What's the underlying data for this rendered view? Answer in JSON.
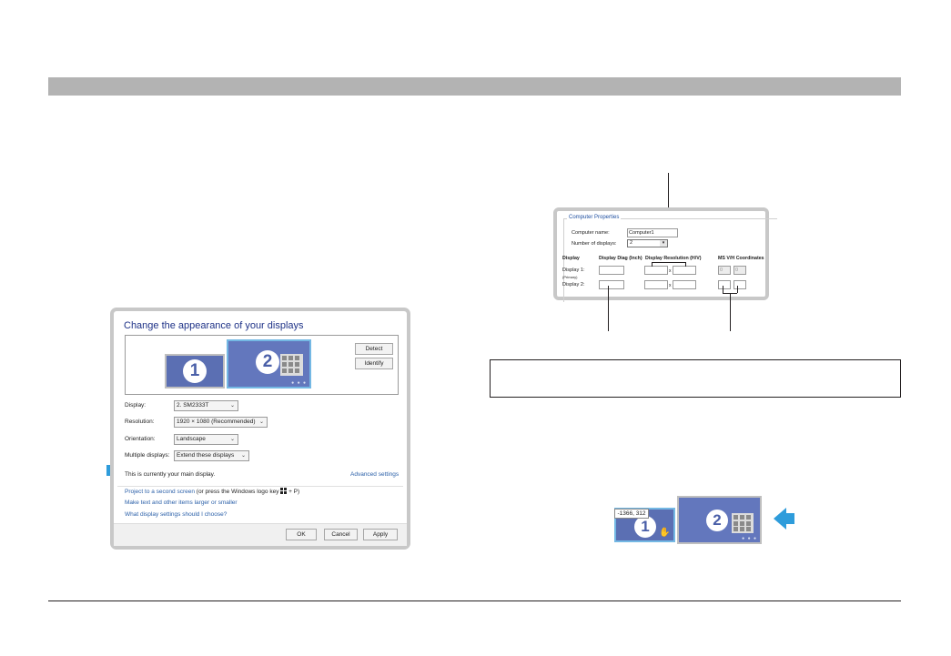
{
  "dialog": {
    "title": "Change the appearance of your displays",
    "monitors": [
      "1",
      "2"
    ],
    "detect_label": "Detect",
    "identify_label": "Identify",
    "display_label": "Display:",
    "display_value": "2. SM2333T",
    "resolution_label": "Resolution:",
    "resolution_value": "1920 × 1080 (Recommended)",
    "orientation_label": "Orientation:",
    "orientation_value": "Landscape",
    "multiple_label": "Multiple displays:",
    "multiple_value": "Extend these displays",
    "main_display_text": "This is currently your main display.",
    "advanced_link": "Advanced settings",
    "project_link": "Project to a second screen",
    "project_rest_1": " (or press the Windows logo key ",
    "project_rest_2": " + P)",
    "text_size_link": "Make text and other items larger or smaller",
    "help_link": "What display settings should I choose?",
    "ok_label": "OK",
    "cancel_label": "Cancel",
    "apply_label": "Apply"
  },
  "properties": {
    "legend": "Computer Properties",
    "computer_name_label": "Computer name:",
    "computer_name_value": "Computer1",
    "num_displays_label": "Number of displays:",
    "num_displays_value": "2",
    "col_display": "Display",
    "col_diag": "Display Diag (Inch)",
    "col_resolution": "Display Resolution (H/V)",
    "col_coords": "MS V/H Coordinates",
    "display1_label": "Display 1:",
    "display1_sub": "(Primary)",
    "display2_label": "Display 2:",
    "times_sign": "x",
    "coord_v_primary": "0",
    "coord_h_primary": "0"
  },
  "arrangement": {
    "coordinate_tooltip": "-1366, 312",
    "monitors": [
      "1",
      "2"
    ]
  },
  "colors": {
    "accent_blue": "#2e9cdb",
    "monitor_blue": "#5b6fb3",
    "link_blue": "#2a5fa8",
    "header_gray": "#b3b3b3"
  }
}
